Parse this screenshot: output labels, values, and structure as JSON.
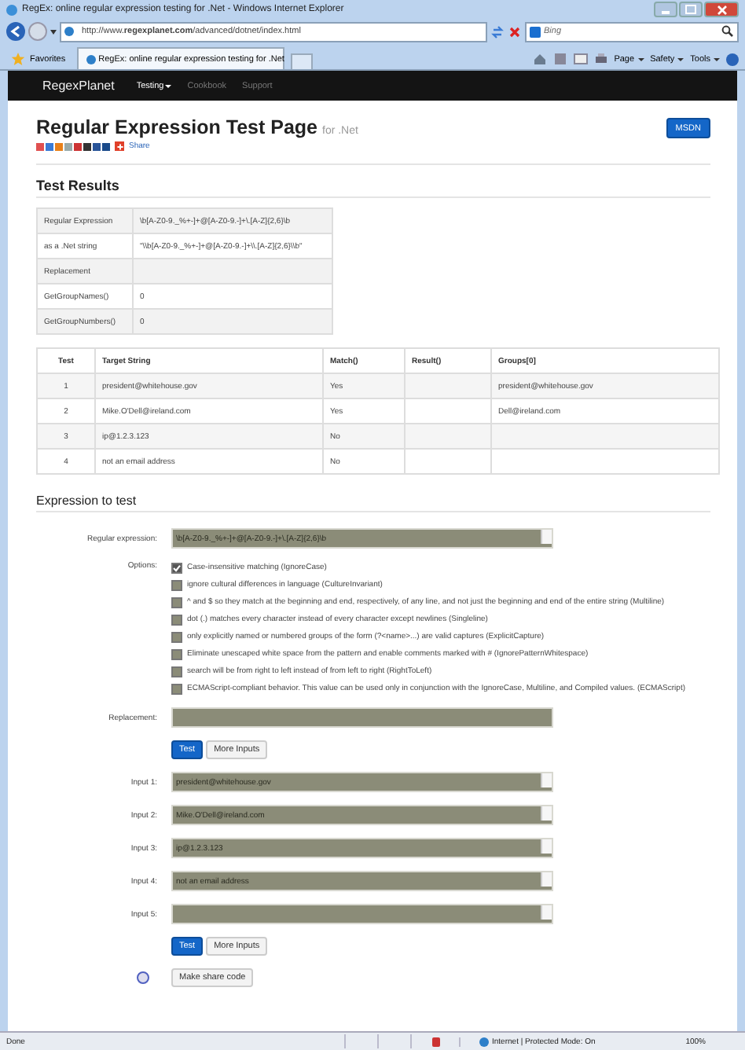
{
  "window": {
    "title": "RegEx: online regular expression testing for .Net - Windows Internet Explorer"
  },
  "address_bar": {
    "url": "http://www.**regexplanet.com**/advanced/dotnet/index.html"
  },
  "search": {
    "placeholder": "Bing"
  },
  "favorites": {
    "label": "Favorites"
  },
  "tabs": [
    {
      "label": "RegEx: online regular expression testing for .Net",
      "selected": true
    }
  ],
  "command_bar": [
    "Page",
    "Safety",
    "Tools"
  ],
  "navbar": {
    "brand": "RegexPlanet",
    "items": [
      {
        "label": "Testing",
        "selected": true,
        "dropdown": true
      },
      {
        "label": "Cookbook",
        "selected": false,
        "dropdown": false
      },
      {
        "label": "Support",
        "selected": false,
        "dropdown": false
      }
    ]
  },
  "header": {
    "title": "Regular Expression Test Page",
    "subtitle": "for .Net",
    "button": "MSDN",
    "share": "Share"
  },
  "results": {
    "heading": "Test Results",
    "summary": [
      {
        "label": "Regular Expression",
        "value": "\\b[A-Z0-9._%+-]+@[A-Z0-9.-]+\\.[A-Z]{2,6}\\b"
      },
      {
        "label": "as a .Net string",
        "value": "\"\\\\b[A-Z0-9._%+-]+@[A-Z0-9.-]+\\\\.[A-Z]{2,6}\\\\b\""
      },
      {
        "label": "Replacement"
      },
      {
        "label": "GetGroupNames()",
        "value": "0"
      },
      {
        "label": "GetGroupNumbers()",
        "value": "0"
      }
    ],
    "table": {
      "columns": [
        "Test",
        "Target String",
        "Match()",
        "Result()",
        "Groups[0]"
      ],
      "rows": [
        {
          "test": "1",
          "target": "president@whitehouse.gov",
          "match": "Yes",
          "groups_0": "president@whitehouse.gov"
        },
        {
          "test": "2",
          "target": "Mike.O'Dell@ireland.com",
          "match": "Yes",
          "groups_0": "Dell@ireland.com"
        },
        {
          "test": "3",
          "target": "ip@1.2.3.123",
          "match": "No"
        },
        {
          "test": "4",
          "target": "not an email address",
          "match": "No"
        }
      ]
    }
  },
  "expression": {
    "heading": "Expression to test",
    "regex_label": "Regular expression:",
    "regex": "\\b[A-Z0-9._%+-]+@[A-Z0-9.-]+\\.[A-Z]{2,6}\\b",
    "options_label": "Options:",
    "options": [
      {
        "label": "Case-insensitive matching (IgnoreCase)",
        "checked": true
      },
      {
        "label": "ignore cultural differences in language (CultureInvariant)",
        "checked": false
      },
      {
        "label": "^ and $ so they match at the beginning and end, respectively, of any line, and not just the beginning and end of the entire string (Multiline)",
        "checked": false
      },
      {
        "label": "dot (.) matches every character instead of every character except newlines (Singleline)",
        "checked": false
      },
      {
        "label": "only explicitly named or numbered groups of the form (?<name>...) are valid captures (ExplicitCapture)",
        "checked": false
      },
      {
        "label": "Eliminate unescaped white space from the pattern and enable comments marked with # (IgnorePatternWhitespace)",
        "checked": false
      },
      {
        "label": "search will be from right to left instead of from left to right (RightToLeft)",
        "checked": false
      },
      {
        "label": "ECMAScript-compliant behavior. This value can be used only in conjunction with the IgnoreCase, Multiline, and Compiled values. (ECMAScript)",
        "checked": false
      }
    ],
    "replacement_label": "Replacement:",
    "buttons_top": [
      {
        "label": "Test",
        "kind": "primary"
      },
      {
        "label": "More Inputs",
        "kind": "default"
      }
    ],
    "inputs": [
      {
        "label": "Input 1:",
        "value": "president@whitehouse.gov"
      },
      {
        "label": "Input 2:",
        "value": "Mike.O'Dell@ireland.com"
      },
      {
        "label": "Input 3:",
        "value": "ip@1.2.3.123"
      },
      {
        "label": "Input 4:",
        "value": "not an email address"
      },
      {
        "label": "Input 5:"
      }
    ],
    "buttons_bottom": [
      {
        "label": "Test",
        "kind": "primary"
      },
      {
        "label": "More Inputs",
        "kind": "default"
      }
    ],
    "share_code_button": "Make share code"
  },
  "status_bar": {
    "status": "Done",
    "zone": "Internet | Protected Mode: On",
    "zoom": "100%"
  }
}
